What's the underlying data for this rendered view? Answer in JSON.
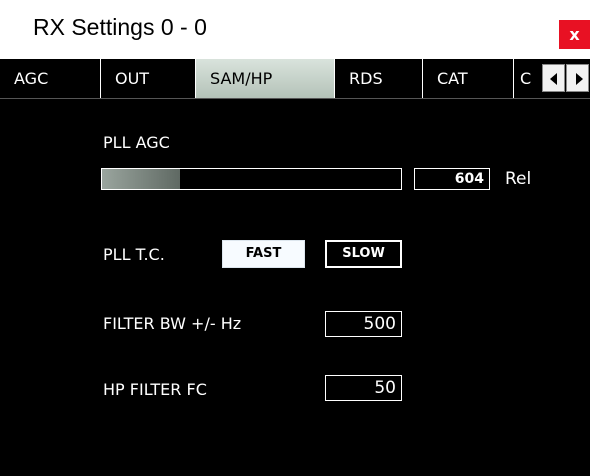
{
  "window": {
    "title": "RX Settings 0 - 0",
    "close_label": "x"
  },
  "tabs": [
    {
      "label": "AGC"
    },
    {
      "label": "OUT"
    },
    {
      "label": "SAM/HP",
      "active": true
    },
    {
      "label": "RDS"
    },
    {
      "label": "CAT"
    },
    {
      "label": "C"
    }
  ],
  "tab_scroll": {
    "left_icon": "arrow-left-icon",
    "right_icon": "arrow-right-icon"
  },
  "pll_agc": {
    "label": "PLL AGC",
    "value": "604",
    "unit": "Rel",
    "level_fraction": 0.26
  },
  "pll_tc": {
    "label": "PLL T.C.",
    "fast_label": "FAST",
    "slow_label": "SLOW",
    "selected": "FAST"
  },
  "filter_bw": {
    "label": "FILTER BW +/- Hz",
    "value": "500"
  },
  "hp_filter": {
    "label": "HP FILTER FC",
    "value": "50"
  },
  "colors": {
    "close_button": "#e81123",
    "active_tab": "#c4d0c7",
    "background": "#000000"
  }
}
